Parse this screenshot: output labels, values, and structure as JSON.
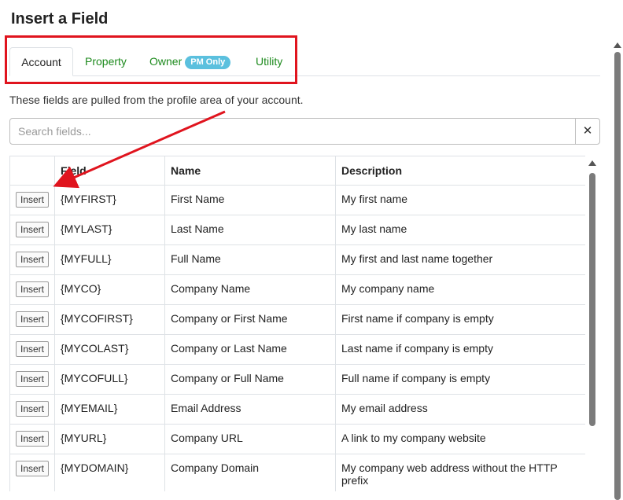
{
  "dialog": {
    "title": "Insert a Field"
  },
  "tabs": [
    {
      "label": "Account",
      "active": true
    },
    {
      "label": "Property",
      "active": false
    },
    {
      "label": "Owner",
      "badge": "PM Only",
      "active": false
    },
    {
      "label": "Utility",
      "active": false
    }
  ],
  "description": "These fields are pulled from the profile area of your account.",
  "search": {
    "placeholder": "Search fields...",
    "value": "",
    "clear_label": "✕"
  },
  "table": {
    "headers": [
      "",
      "Field",
      "Name",
      "Description"
    ],
    "insert_label": "Insert",
    "rows": [
      {
        "field": "{MYFIRST}",
        "name": "First Name",
        "description": "My first name"
      },
      {
        "field": "{MYLAST}",
        "name": "Last Name",
        "description": "My last name"
      },
      {
        "field": "{MYFULL}",
        "name": "Full Name",
        "description": "My first and last name together"
      },
      {
        "field": "{MYCO}",
        "name": "Company Name",
        "description": "My company name"
      },
      {
        "field": "{MYCOFIRST}",
        "name": "Company or First Name",
        "description": "First name if company is empty"
      },
      {
        "field": "{MYCOLAST}",
        "name": "Company or Last Name",
        "description": "Last name if company is empty"
      },
      {
        "field": "{MYCOFULL}",
        "name": "Company or Full Name",
        "description": "Full name if company is empty"
      },
      {
        "field": "{MYEMAIL}",
        "name": "Email Address",
        "description": "My email address"
      },
      {
        "field": "{MYURL}",
        "name": "Company URL",
        "description": "A link to my company website"
      },
      {
        "field": "{MYDOMAIN}",
        "name": "Company Domain",
        "description": "My company web address without the HTTP prefix"
      }
    ]
  },
  "colors": {
    "link": "#1d8a1d",
    "badge": "#5bc0de",
    "annotation": "#e0141e"
  }
}
